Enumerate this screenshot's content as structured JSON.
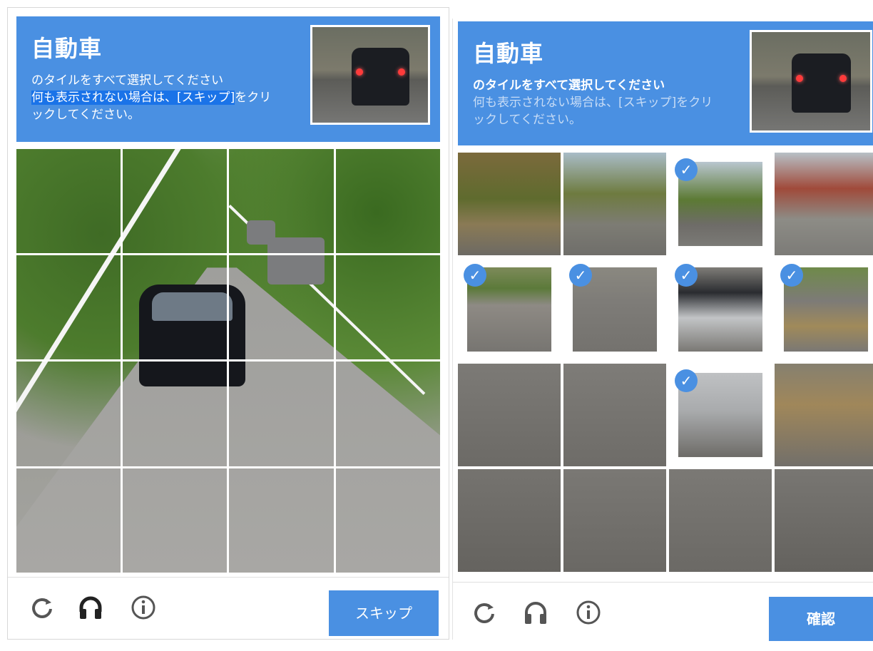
{
  "left_panel": {
    "header": {
      "keyword": "自動車",
      "line1": "のタイルをすべて選択してください",
      "line2a": "何も表示されない場合は、[スキップ]",
      "line2b": "をクリ",
      "line3": "ックしてください。"
    },
    "footer": {
      "reload_icon": "reload-icon",
      "audio_icon": "headphones-icon",
      "info_icon": "info-icon",
      "button_label": "スキップ"
    }
  },
  "right_panel": {
    "header": {
      "keyword": "自動車",
      "line1": "のタイルをすべて選択してください",
      "line2": "何も表示されない場合は、[スキップ]をクリ",
      "line3": "ックしてください。"
    },
    "tiles": [
      {
        "row": 0,
        "col": 0,
        "selected": false
      },
      {
        "row": 0,
        "col": 1,
        "selected": false
      },
      {
        "row": 0,
        "col": 2,
        "selected": true
      },
      {
        "row": 0,
        "col": 3,
        "selected": false
      },
      {
        "row": 1,
        "col": 0,
        "selected": true
      },
      {
        "row": 1,
        "col": 1,
        "selected": true
      },
      {
        "row": 1,
        "col": 2,
        "selected": true
      },
      {
        "row": 1,
        "col": 3,
        "selected": true
      },
      {
        "row": 2,
        "col": 0,
        "selected": false
      },
      {
        "row": 2,
        "col": 1,
        "selected": false
      },
      {
        "row": 2,
        "col": 2,
        "selected": true
      },
      {
        "row": 2,
        "col": 3,
        "selected": false
      },
      {
        "row": 3,
        "col": 0,
        "selected": false
      },
      {
        "row": 3,
        "col": 1,
        "selected": false
      },
      {
        "row": 3,
        "col": 2,
        "selected": false
      },
      {
        "row": 3,
        "col": 3,
        "selected": false
      }
    ],
    "footer": {
      "reload_icon": "reload-icon",
      "audio_icon": "headphones-icon",
      "info_icon": "info-icon",
      "button_label": "確認"
    }
  },
  "colors": {
    "accent": "#4a90e2",
    "highlight": "#1a73e8"
  }
}
